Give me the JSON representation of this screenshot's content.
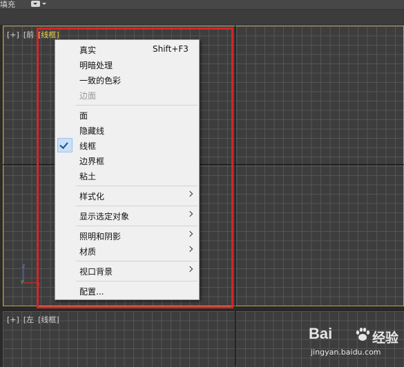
{
  "toolbar": {
    "fill_label": "填充"
  },
  "viewports": {
    "front": {
      "plus": "[+]",
      "view": "[前",
      "mode": "[线框]"
    },
    "left": {
      "plus": "[+]",
      "view": "[左",
      "mode": "[线框]"
    },
    "gizmo": {
      "z_label": "z",
      "y_label": "y",
      "x_label": "x"
    }
  },
  "menu": {
    "realistic": "真实",
    "realistic_shortcut": "Shift+F3",
    "shaded": "明暗处理",
    "consistent_colors": "一致的色彩",
    "edged_faces": "边面",
    "facets": "面",
    "hidden_line": "隐藏线",
    "wireframe": "线框",
    "bounding_box": "边界框",
    "clay": "粘土",
    "stylized": "样式化",
    "display_selected": "显示选定对象",
    "lighting_shadows": "照明和阴影",
    "materials": "材质",
    "viewport_background": "视口背景",
    "configure": "配置..."
  },
  "watermark": {
    "logo_text": "Bai",
    "logo_suffix": "经验",
    "url": "jingyan.baidu.com"
  },
  "colors": {
    "highlight_box": "#d3262a",
    "active_view_label": "#f2d24b",
    "active_border": "#c8a24a"
  }
}
